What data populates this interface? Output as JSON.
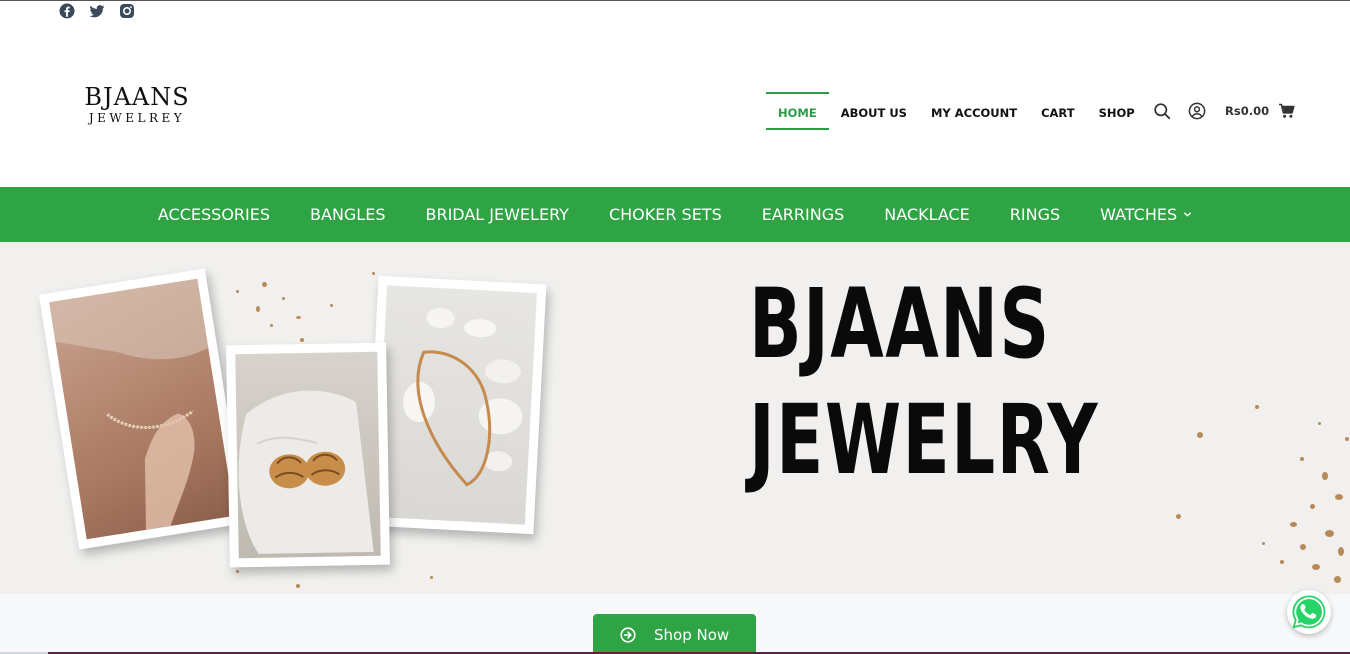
{
  "social": {
    "icons": [
      "facebook-icon",
      "twitter-icon",
      "instagram-icon"
    ],
    "color": "#3a4a5c"
  },
  "brand": {
    "line1": "BJAANS",
    "line2": "JEWELREY"
  },
  "main_nav": {
    "items": [
      "HOME",
      "ABOUT US",
      "MY ACCOUNT",
      "CART",
      "SHOP"
    ],
    "active": "HOME",
    "active_color": "#2e9b46"
  },
  "header_tools": {
    "icons": [
      "search-icon",
      "user-account-icon",
      "cart-icon"
    ],
    "cart_total": "Rs0.00"
  },
  "category_nav": {
    "background": "#2fa445",
    "items": [
      "ACCESSORIES",
      "BANGLES",
      "BRIDAL JEWELERY",
      "CHOKER SETS",
      "EARRINGS",
      "NACKLACE",
      "RINGS",
      "WATCHES"
    ],
    "dropdown_item": "WATCHES"
  },
  "hero": {
    "title_line1": "BJAANS",
    "title_line2": "JEWELRY",
    "photos": [
      "necklace-on-neck-photo",
      "gold-earrings-on-rock-photo",
      "gold-chain-on-stones-photo"
    ]
  },
  "cta": {
    "label": "Shop Now",
    "icon": "arrow-circle-right-icon"
  },
  "floating": {
    "icon": "whatsapp-icon",
    "color": "#25d366"
  }
}
